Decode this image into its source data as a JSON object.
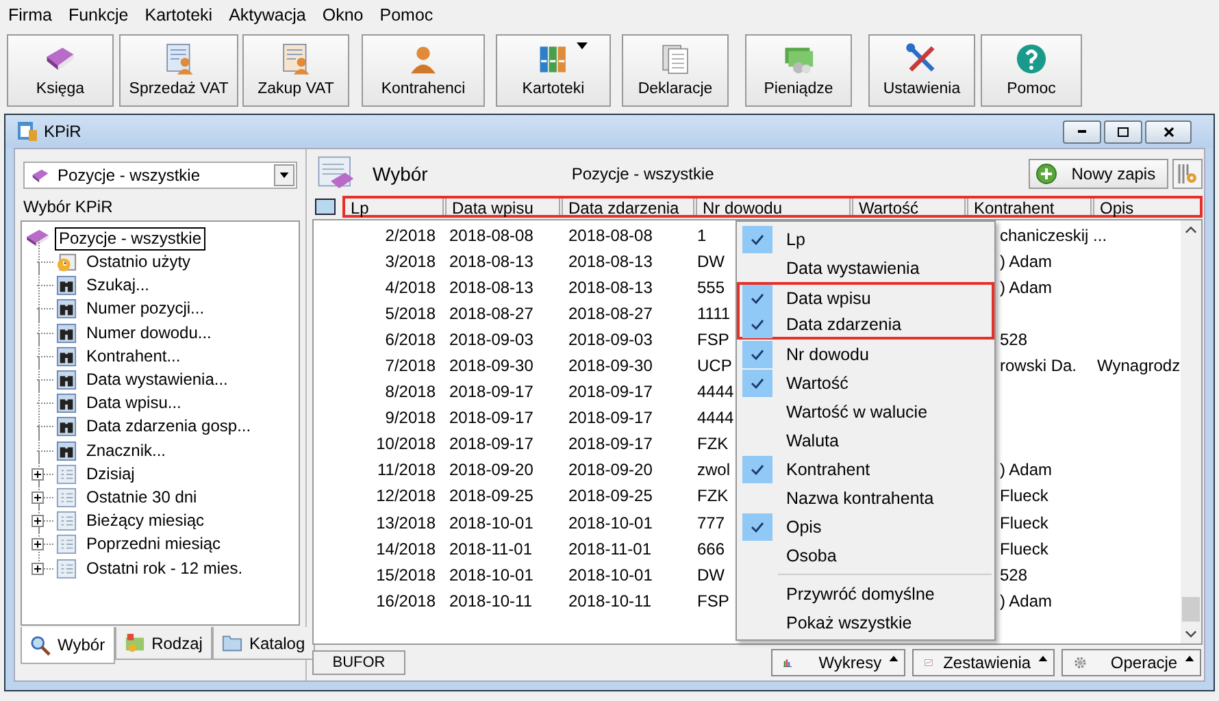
{
  "menu_bar": [
    "Firma",
    "Funkcje",
    "Kartoteki",
    "Aktywacja",
    "Okno",
    "Pomoc"
  ],
  "toolbar": [
    {
      "label": "Księga",
      "kind": "book",
      "has_menu": false
    },
    {
      "label": "Sprzedaż VAT",
      "kind": "sale",
      "has_menu": false
    },
    {
      "label": "Zakup VAT",
      "kind": "purchase",
      "has_menu": false
    },
    {
      "label": "Kontrahenci",
      "kind": "person",
      "has_menu": false
    },
    {
      "label": "Kartoteki",
      "kind": "binders",
      "has_menu": true
    },
    {
      "label": "Deklaracje",
      "kind": "forms",
      "has_menu": false
    },
    {
      "label": "Pieniądze",
      "kind": "money",
      "has_menu": false
    },
    {
      "label": "Ustawienia",
      "kind": "tools",
      "has_menu": false
    },
    {
      "label": "Pomoc",
      "kind": "help",
      "has_menu": false
    }
  ],
  "window": {
    "title": "KPiR"
  },
  "sidebar": {
    "dropdown": "Pozycje - wszystkie",
    "label": "Wybór KPiR",
    "tree": {
      "label": "Pozycje - wszystkie",
      "selected": true,
      "children": [
        {
          "label": "Ostatnio użyty",
          "kind": "recent",
          "expandable": false
        },
        {
          "label": "Szukaj...",
          "kind": "search",
          "expandable": false
        },
        {
          "label": "Numer pozycji...",
          "kind": "search",
          "expandable": false
        },
        {
          "label": "Numer dowodu...",
          "kind": "search",
          "expandable": false
        },
        {
          "label": "Kontrahent...",
          "kind": "search",
          "expandable": false
        },
        {
          "label": "Data wystawienia...",
          "kind": "search",
          "expandable": false
        },
        {
          "label": "Data wpisu...",
          "kind": "search",
          "expandable": false
        },
        {
          "label": "Data zdarzenia gosp...",
          "kind": "search",
          "expandable": false
        },
        {
          "label": "Znacznik...",
          "kind": "search",
          "expandable": false
        },
        {
          "label": "Dzisiaj",
          "kind": "list",
          "expandable": true
        },
        {
          "label": "Ostatnie 30 dni",
          "kind": "list",
          "expandable": true
        },
        {
          "label": "Bieżący miesiąc",
          "kind": "list",
          "expandable": true
        },
        {
          "label": "Poprzedni miesiąc",
          "kind": "list",
          "expandable": true
        },
        {
          "label": "Ostatni rok - 12 mies.",
          "kind": "list",
          "expandable": true
        }
      ]
    },
    "tabs": [
      {
        "label": "Wybór",
        "kind": "search",
        "selected": true
      },
      {
        "label": "Rodzaj",
        "kind": "folder-color",
        "selected": false
      },
      {
        "label": "Katalog",
        "kind": "folder",
        "selected": false
      }
    ]
  },
  "main": {
    "title": "Wybór",
    "subtitle": "Pozycje - wszystkie",
    "new_button": "Nowy zapis",
    "table": {
      "header_highlighted": true,
      "columns": [
        "Lp",
        "Data wpisu",
        "Data zdarzenia",
        "Nr dowodu",
        "Wartość",
        "Kontrahent",
        "Opis"
      ],
      "rows": [
        {
          "lp": "2/2018",
          "data_wpisu": "2018-08-08",
          "data_zdarzenia": "2018-08-08",
          "nr_dowodu": "1",
          "kontrahent": "chaniczeskij ..."
        },
        {
          "lp": "3/2018",
          "data_wpisu": "2018-08-13",
          "data_zdarzenia": "2018-08-13",
          "nr_dowodu": "DW",
          "kontrahent": ") Adam"
        },
        {
          "lp": "4/2018",
          "data_wpisu": "2018-08-13",
          "data_zdarzenia": "2018-08-13",
          "nr_dowodu": "555",
          "kontrahent": ") Adam"
        },
        {
          "lp": "5/2018",
          "data_wpisu": "2018-08-27",
          "data_zdarzenia": "2018-08-27",
          "nr_dowodu": "1111"
        },
        {
          "lp": "6/2018",
          "data_wpisu": "2018-09-03",
          "data_zdarzenia": "2018-09-03",
          "nr_dowodu": "FSP",
          "kontrahent": "528"
        },
        {
          "lp": "7/2018",
          "data_wpisu": "2018-09-30",
          "data_zdarzenia": "2018-09-30",
          "nr_dowodu": "UCP",
          "kontrahent": "rowski Da.",
          "opis": "Wynagrodz"
        },
        {
          "lp": "8/2018",
          "data_wpisu": "2018-09-17",
          "data_zdarzenia": "2018-09-17",
          "nr_dowodu": "4444"
        },
        {
          "lp": "9/2018",
          "data_wpisu": "2018-09-17",
          "data_zdarzenia": "2018-09-17",
          "nr_dowodu": "4444"
        },
        {
          "lp": "10/2018",
          "data_wpisu": "2018-09-17",
          "data_zdarzenia": "2018-09-17",
          "nr_dowodu": "FZK"
        },
        {
          "lp": "11/2018",
          "data_wpisu": "2018-09-20",
          "data_zdarzenia": "2018-09-20",
          "nr_dowodu": "zwol",
          "kontrahent": ") Adam"
        },
        {
          "lp": "12/2018",
          "data_wpisu": "2018-09-25",
          "data_zdarzenia": "2018-09-25",
          "nr_dowodu": "FZK",
          "kontrahent": "Flueck"
        },
        {
          "lp": "13/2018",
          "data_wpisu": "2018-10-01",
          "data_zdarzenia": "2018-10-01",
          "nr_dowodu": "777",
          "kontrahent": "Flueck"
        },
        {
          "lp": "14/2018",
          "data_wpisu": "2018-11-01",
          "data_zdarzenia": "2018-11-01",
          "nr_dowodu": "666",
          "kontrahent": "Flueck"
        },
        {
          "lp": "15/2018",
          "data_wpisu": "2018-10-01",
          "data_zdarzenia": "2018-10-01",
          "nr_dowodu": "DW",
          "kontrahent": "528"
        },
        {
          "lp": "16/2018",
          "data_wpisu": "2018-10-11",
          "data_zdarzenia": "2018-10-11",
          "nr_dowodu": "FSP",
          "kontrahent": ") Adam"
        }
      ]
    },
    "column_menu": [
      {
        "label": "Lp",
        "kind": "option",
        "checked": true,
        "highlighted": false
      },
      {
        "label": "Data wystawienia",
        "kind": "option",
        "checked": false,
        "highlighted": false
      },
      {
        "label": "Data wpisu",
        "kind": "option",
        "checked": true,
        "highlighted": true
      },
      {
        "label": "Data zdarzenia",
        "kind": "option",
        "checked": true,
        "highlighted": true
      },
      {
        "label": "Nr dowodu",
        "kind": "option",
        "checked": true,
        "highlighted": false
      },
      {
        "label": "Wartość",
        "kind": "option",
        "checked": true,
        "highlighted": false
      },
      {
        "label": "Wartość w walucie",
        "kind": "option",
        "checked": false,
        "highlighted": false
      },
      {
        "label": "Waluta",
        "kind": "option",
        "checked": false,
        "highlighted": false
      },
      {
        "label": "Kontrahent",
        "kind": "option",
        "checked": true,
        "highlighted": false
      },
      {
        "label": "Nazwa kontrahenta",
        "kind": "option",
        "checked": false,
        "highlighted": false
      },
      {
        "label": "Opis",
        "kind": "option",
        "checked": true,
        "highlighted": false
      },
      {
        "label": "Osoba",
        "kind": "option",
        "checked": false,
        "highlighted": false
      },
      {
        "label": "Przywróć domyślne",
        "kind": "action",
        "highlighted": false
      },
      {
        "label": "Pokaż wszystkie",
        "kind": "action",
        "highlighted": false
      }
    ],
    "bottom_left": "BUFOR",
    "bottom_buttons": [
      {
        "label": "Wykresy",
        "kind": "chart"
      },
      {
        "label": "Zestawienia",
        "kind": "report"
      },
      {
        "label": "Operacje",
        "kind": "gear"
      }
    ]
  }
}
